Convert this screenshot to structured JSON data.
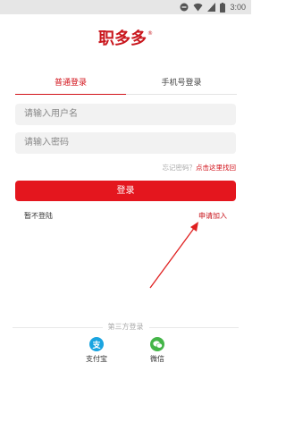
{
  "status_bar": {
    "time": "3:00"
  },
  "logo": {
    "text": "职多多",
    "reg": "®"
  },
  "tabs": {
    "normal_login": "普通登录",
    "phone_login": "手机号登录"
  },
  "form": {
    "username_placeholder": "请输入用户名",
    "password_placeholder": "请输入密码"
  },
  "forgot": {
    "question": "忘记密码？",
    "link": "点击这里找回"
  },
  "login_button": "登录",
  "skip_login": "暂不登陆",
  "apply_join": "申请加入",
  "third_party": {
    "title": "第三方登录",
    "alipay": {
      "label": "支付宝",
      "icon_text": "支"
    },
    "wechat": {
      "label": "微信",
      "icon_text": ""
    }
  },
  "colors": {
    "accent": "#e4161e",
    "alipay": "#1aa4e0",
    "wechat": "#44b548"
  }
}
